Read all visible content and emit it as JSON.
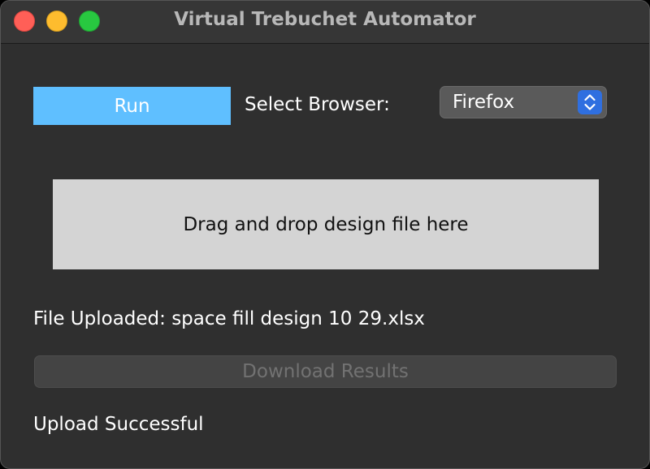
{
  "window": {
    "title": "Virtual Trebuchet Automator"
  },
  "traffic_lights": {
    "close_color": "#ff5f57",
    "minimize_color": "#febc2e",
    "zoom_color": "#28c840"
  },
  "controls": {
    "run_label": "Run",
    "run_color": "#5fbfff",
    "browser_label": "Select Browser:",
    "browser_selected": "Firefox",
    "stepper_icon": "up-down-chevron-icon",
    "stepper_color": "#2f6fe0"
  },
  "drop_zone": {
    "label": "Drag and drop design file here"
  },
  "status": {
    "file_uploaded": "File Uploaded: space fill design 10 29.xlsx",
    "download_label": "Download Results",
    "download_enabled": false,
    "upload_message": "Upload Successful"
  }
}
